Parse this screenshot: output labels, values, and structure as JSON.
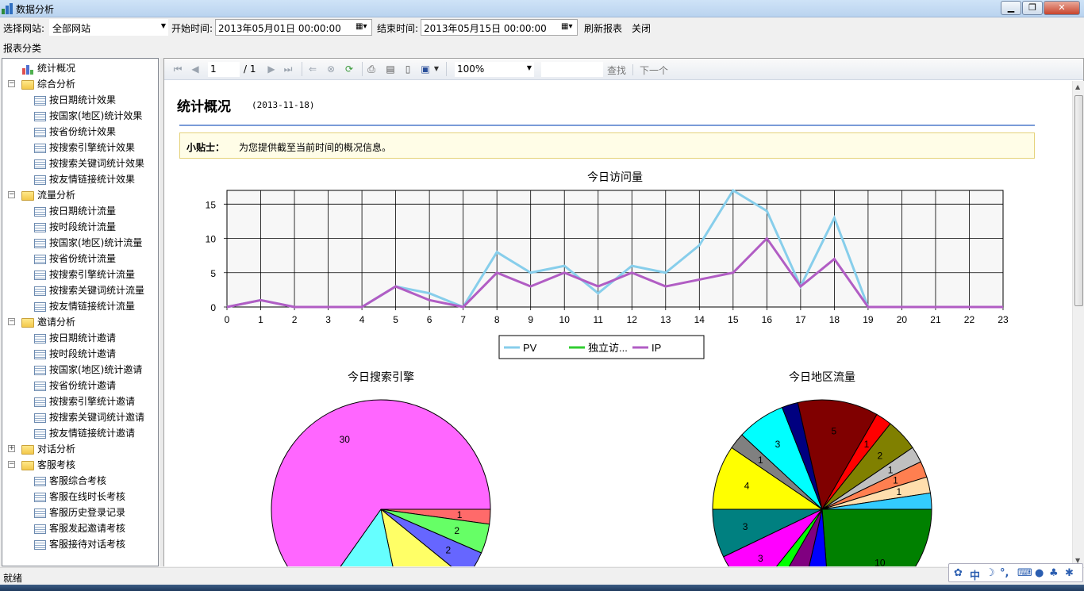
{
  "window": {
    "title": "数据分析",
    "minimize": "▁",
    "maximize": "❐",
    "close": "✕"
  },
  "toolbar": {
    "site_label": "选择网站:",
    "site_value": "全部网站",
    "start_label": "开始时间:",
    "start_value": "2013年05月01日 00:00:00",
    "end_label": "结束时间:",
    "end_value": "2013年05月15日 00:00:00",
    "refresh_label": "刷新报表",
    "close_label": "关闭"
  },
  "sidebar": {
    "header": "报表分类",
    "items": [
      {
        "label": "统计概况",
        "level": 0,
        "kind": "stats"
      },
      {
        "label": "综合分析",
        "level": 0,
        "kind": "folder",
        "toggle": "−"
      },
      {
        "label": "按日期统计效果",
        "level": 1,
        "kind": "report"
      },
      {
        "label": "按国家(地区)统计效果",
        "level": 1,
        "kind": "report"
      },
      {
        "label": "按省份统计效果",
        "level": 1,
        "kind": "report"
      },
      {
        "label": "按搜索引擎统计效果",
        "level": 1,
        "kind": "report"
      },
      {
        "label": "按搜索关键词统计效果",
        "level": 1,
        "kind": "report"
      },
      {
        "label": "按友情链接统计效果",
        "level": 1,
        "kind": "report"
      },
      {
        "label": "流量分析",
        "level": 0,
        "kind": "folder",
        "toggle": "−"
      },
      {
        "label": "按日期统计流量",
        "level": 1,
        "kind": "report"
      },
      {
        "label": "按时段统计流量",
        "level": 1,
        "kind": "report"
      },
      {
        "label": "按国家(地区)统计流量",
        "level": 1,
        "kind": "report"
      },
      {
        "label": "按省份统计流量",
        "level": 1,
        "kind": "report"
      },
      {
        "label": "按搜索引擎统计流量",
        "level": 1,
        "kind": "report"
      },
      {
        "label": "按搜索关键词统计流量",
        "level": 1,
        "kind": "report"
      },
      {
        "label": "按友情链接统计流量",
        "level": 1,
        "kind": "report"
      },
      {
        "label": "邀请分析",
        "level": 0,
        "kind": "folder",
        "toggle": "−"
      },
      {
        "label": "按日期统计邀请",
        "level": 1,
        "kind": "report"
      },
      {
        "label": "按时段统计邀请",
        "level": 1,
        "kind": "report"
      },
      {
        "label": "按国家(地区)统计邀请",
        "level": 1,
        "kind": "report"
      },
      {
        "label": "按省份统计邀请",
        "level": 1,
        "kind": "report"
      },
      {
        "label": "按搜索引擎统计邀请",
        "level": 1,
        "kind": "report"
      },
      {
        "label": "按搜索关键词统计邀请",
        "level": 1,
        "kind": "report"
      },
      {
        "label": "按友情链接统计邀请",
        "level": 1,
        "kind": "report"
      },
      {
        "label": "对话分析",
        "level": 0,
        "kind": "folder",
        "toggle": "+"
      },
      {
        "label": "客服考核",
        "level": 0,
        "kind": "folder",
        "toggle": "−"
      },
      {
        "label": "客服综合考核",
        "level": 1,
        "kind": "report"
      },
      {
        "label": "客服在线时长考核",
        "level": 1,
        "kind": "report"
      },
      {
        "label": "客服历史登录记录",
        "level": 1,
        "kind": "report"
      },
      {
        "label": "客服发起邀请考核",
        "level": 1,
        "kind": "report"
      },
      {
        "label": "客服接待对话考核",
        "level": 1,
        "kind": "report"
      }
    ]
  },
  "viewer_toolbar": {
    "page_current": "1",
    "page_total": "/ 1",
    "zoom": "100%",
    "search_value": "",
    "find_label": "查找",
    "find_next_label": "下一个"
  },
  "report": {
    "title": "统计概况",
    "date": "(2013-11-18)",
    "tip_label": "小贴士：",
    "tip_text": "为您提供截至当前时间的概况信息。"
  },
  "status": {
    "text": "就绪"
  },
  "ime": {
    "zh": "中",
    "moon": "☽",
    "dot": "°,"
  },
  "colors": {
    "pv": "#87CEEB",
    "visitor": "#32CD32",
    "ip": "#B15DC4",
    "accent_rule": "#7a9bd8"
  },
  "chart_data": [
    {
      "type": "line",
      "title": "今日访问量",
      "x": [
        0,
        1,
        2,
        3,
        4,
        5,
        6,
        7,
        8,
        9,
        10,
        11,
        12,
        13,
        14,
        15,
        16,
        17,
        18,
        19,
        20,
        21,
        22,
        23
      ],
      "ylim": [
        0,
        17
      ],
      "yticks": [
        0,
        5,
        10,
        15
      ],
      "grid": true,
      "legend_position": "bottom",
      "series": [
        {
          "name": "PV",
          "color": "#87CEEB",
          "values": [
            0,
            1,
            0,
            0,
            0,
            3,
            2,
            0,
            8,
            5,
            6,
            2,
            6,
            5,
            9,
            17,
            14,
            3,
            13,
            0,
            0,
            0,
            0,
            0
          ]
        },
        {
          "name": "独立访...",
          "color": "#32CD32",
          "values": []
        },
        {
          "name": "IP",
          "color": "#B15DC4",
          "values": [
            0,
            1,
            0,
            0,
            0,
            3,
            1,
            0,
            5,
            3,
            5,
            3,
            5,
            3,
            4,
            5,
            10,
            3,
            7,
            0,
            0,
            0,
            0,
            0
          ]
        }
      ]
    },
    {
      "type": "pie",
      "title": "今日搜索引擎",
      "slices": [
        {
          "value": 1,
          "color": "#FF6A6A"
        },
        {
          "value": 2,
          "color": "#66FF66"
        },
        {
          "value": 2,
          "color": "#6666FF"
        },
        {
          "value": 5,
          "color": "#FFFF66"
        },
        {
          "value": 6,
          "color": "#66FFFF"
        },
        {
          "value": 30,
          "color": "#FF66FF"
        }
      ]
    },
    {
      "type": "pie",
      "title": "今日地区流量",
      "slices": [
        {
          "value": 10,
          "color": "#008000",
          "label": "10"
        },
        {
          "value": 2,
          "color": "#0000FF",
          "label": "2"
        },
        {
          "value": 2,
          "color": "#800080",
          "label": "2"
        },
        {
          "value": 1,
          "color": "#00FF00",
          "label": "1"
        },
        {
          "value": 3,
          "color": "#FF00FF",
          "label": "3"
        },
        {
          "value": 3,
          "color": "#008080",
          "label": "3"
        },
        {
          "value": 4,
          "color": "#FFFF00",
          "label": "4"
        },
        {
          "value": 1,
          "color": "#808080",
          "label": "1"
        },
        {
          "value": 3,
          "color": "#00FFFF",
          "label": "3"
        },
        {
          "value": 1,
          "color": "#000080",
          "label": ""
        },
        {
          "value": 5,
          "color": "#800000",
          "label": "5"
        },
        {
          "value": 1,
          "color": "#FF0000",
          "label": "1"
        },
        {
          "value": 2,
          "color": "#808000",
          "label": "2"
        },
        {
          "value": 1,
          "color": "#C0C0C0",
          "label": "1"
        },
        {
          "value": 1,
          "color": "#FF7F50",
          "label": "1"
        },
        {
          "value": 1,
          "color": "#FFDEAD",
          "label": "1"
        },
        {
          "value": 1,
          "color": "#33CCFF",
          "label": ""
        }
      ]
    }
  ]
}
